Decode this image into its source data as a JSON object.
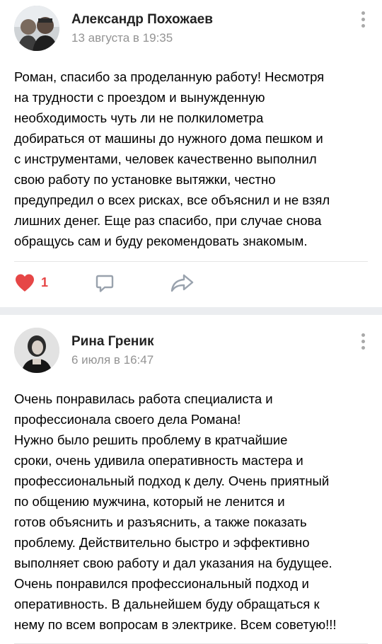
{
  "posts": [
    {
      "author": "Александр Похожаев",
      "date": "13 августа в 19:35",
      "lines": [
        "Роман, спасибо за проделанную работу! Несмотря",
        "на трудности с проездом и вынужденную",
        "необходимость чуть ли не полкилометра",
        "добираться от машины до нужного дома пешком и",
        "с инструментами, человек качественно выполнил",
        "свою работу по установке вытяжки, честно",
        "предупредил о всех рисках, все объяснил и не взял",
        "лишних денег. Еще раз спасибо, при случае снова",
        "обращусь сам и буду рекомендовать знакомым."
      ],
      "likes": "1",
      "liked": true
    },
    {
      "author": "Рина Греник",
      "date": "6 июля в 16:47",
      "lines": [
        "Очень понравилась работа специалиста и",
        "профессионала своего дела Романа!",
        "Нужно было решить проблему в кратчайшие",
        "сроки, очень удивила оперативность мастера и",
        "профессиональный подход к делу. Очень приятный",
        "по общению мужчина, который не ленится и",
        "готов объяснить и разъяснить, а также показать",
        "проблему. Действительно быстро и эффективно",
        "выполняет свою работу и дал указания на будущее.",
        "Очень понравился профессиональный подход и",
        "оперативность. В дальнейшем буду обращаться к",
        "нему по всем вопросам в электрике. Всем советую!!!"
      ]
    }
  ],
  "icons": {
    "like": "heart-icon",
    "comment": "comment-icon",
    "share": "share-icon",
    "more": "more-vertical-icon"
  },
  "colors": {
    "like": "#e64646",
    "icon": "#99a2ad",
    "secondary_text": "#939393",
    "separator": "#ebedf0"
  }
}
